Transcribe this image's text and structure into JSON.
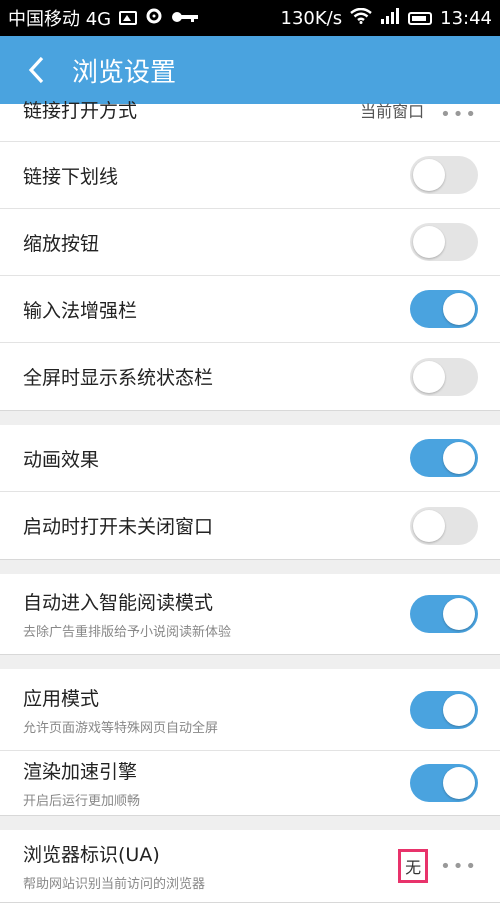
{
  "status_bar": {
    "carrier": "中国移动 4G",
    "speed": "130K/s",
    "time": "13:44"
  },
  "header": {
    "title": "浏览设置"
  },
  "settings": {
    "link_open_mode": {
      "label": "链接打开方式",
      "value": "当前窗口"
    },
    "link_underline": {
      "label": "链接下划线",
      "enabled": false
    },
    "zoom_buttons": {
      "label": "缩放按钮",
      "enabled": false
    },
    "ime_enhance_bar": {
      "label": "输入法增强栏",
      "enabled": true
    },
    "fullscreen_status_bar": {
      "label": "全屏时显示系统状态栏",
      "enabled": false
    },
    "animation": {
      "label": "动画效果",
      "enabled": true
    },
    "restore_windows": {
      "label": "启动时打开未关闭窗口",
      "enabled": false
    },
    "smart_reading": {
      "label": "自动进入智能阅读模式",
      "sub": "去除广告重排版给予小说阅读新体验",
      "enabled": true
    },
    "app_mode": {
      "label": "应用模式",
      "sub": "允许页面游戏等特殊网页自动全屏",
      "enabled": true
    },
    "render_accel": {
      "label": "渲染加速引擎",
      "sub": "开启后运行更加顺畅",
      "enabled": true
    },
    "user_agent": {
      "label": "浏览器标识(UA)",
      "sub": "帮助网站识别当前访问的浏览器",
      "value": "无"
    }
  },
  "colors": {
    "accent": "#4aa3df",
    "toggle_off": "#e4e4e4",
    "highlight_box": "#e8336b"
  },
  "icons": {
    "back": "chevron-left-icon",
    "more": "more-dots-icon"
  }
}
